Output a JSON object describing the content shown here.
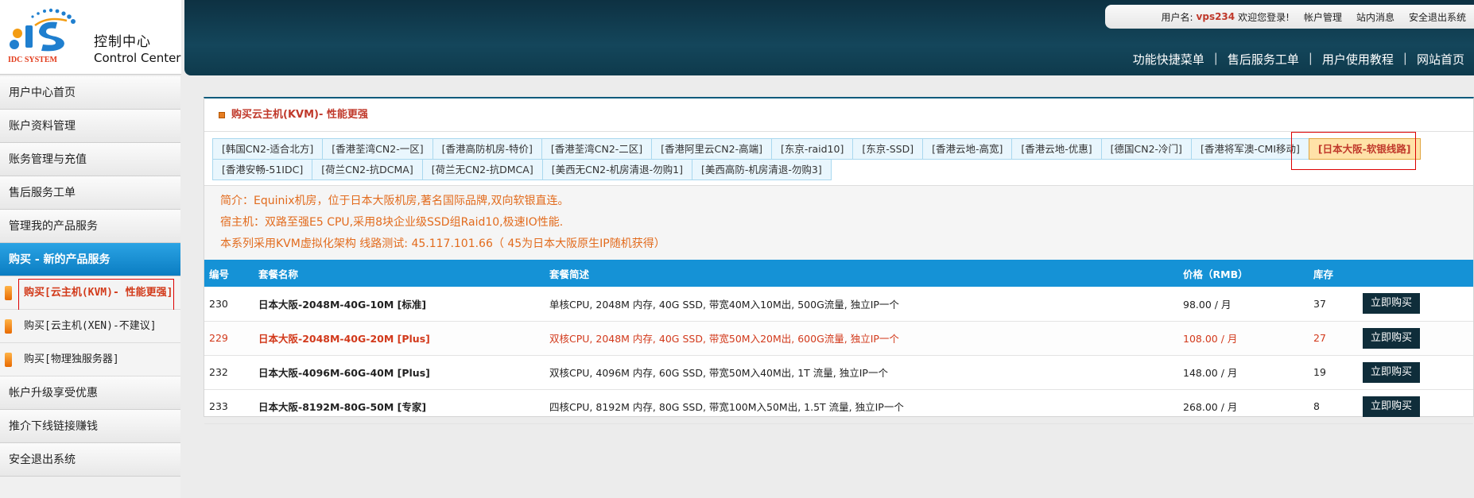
{
  "logo": {
    "brand": "IDC SYSTEM",
    "title_cn": "控制中心",
    "title_en": "Control Center"
  },
  "userbar": {
    "label": "用户名:",
    "username": "vps234",
    "welcome": "欢迎您登录!",
    "links": [
      "帐户管理",
      "站内消息",
      "安全退出系统"
    ]
  },
  "quicknav": [
    "功能快捷菜单",
    "售后服务工单",
    "用户使用教程",
    "网站首页"
  ],
  "sidebar": {
    "items": [
      "用户中心首页",
      "账户资料管理",
      "账务管理与充值",
      "售后服务工单",
      "管理我的产品服务"
    ],
    "active": "购买 - 新的产品服务",
    "sub": [
      "购买[云主机(KVM)- 性能更强]",
      "购买[云主机(XEN)-不建议]",
      "购买[物理独服务器]"
    ],
    "bottom": [
      "帐户升级享受优惠",
      "推介下线链接赚钱",
      "安全退出系统"
    ]
  },
  "panel": {
    "title": "购买云主机(KVM)- 性能更强",
    "tabs": [
      "[韩国CN2-适合北方]",
      "[香港荃湾CN2-一区]",
      "[香港高防机房-特价]",
      "[香港荃湾CN2-二区]",
      "[香港阿里云CN2-高端]",
      "[东京-raid10]",
      "[东京-SSD]",
      "[香港云地-高宽]",
      "[香港云地-优惠]",
      "[德国CN2-冷门]",
      "[香港将军澳-CMI移动]",
      "[日本大阪-软银线路]",
      "[香港安畅-51IDC]",
      "[荷兰CN2-抗DCMA]",
      "[荷兰无CN2-抗DMCA]",
      "[美西无CN2-机房清退-勿购1]",
      "[美西高防-机房清退-勿购3]"
    ],
    "active_tab_index": 11,
    "intro": [
      "简介：Equinix机房，位于日本大阪机房,著名国际品牌,双向软银直连。",
      "宿主机：双路至强E5 CPU,采用8块企业级SSD组Raid10,极速IO性能.",
      "本系列采用KVM虚拟化架构 线路测试: 45.117.101.66（ 45为日本大阪原生IP随机获得）"
    ]
  },
  "table": {
    "headers": [
      "编号",
      "套餐名称",
      "套餐简述",
      "价格（RMB）",
      "库存",
      ""
    ],
    "buy_label": "立即购买",
    "rows": [
      {
        "id": "230",
        "name": "日本大阪-2048M-40G-10M [标准]",
        "desc": "单核CPU, 2048M 内存, 40G SSD, 带宽40M入10M出, 500G流量, 独立IP一个",
        "price": "98.00 / 月",
        "stock": "37"
      },
      {
        "id": "229",
        "name": "日本大阪-2048M-40G-20M [Plus]",
        "desc": "双核CPU, 2048M 内存, 40G SSD, 带宽50M入20M出, 600G流量, 独立IP一个",
        "price": "108.00 / 月",
        "stock": "27"
      },
      {
        "id": "232",
        "name": "日本大阪-4096M-60G-40M [Plus]",
        "desc": "双核CPU, 4096M 内存, 60G SSD, 带宽50M入40M出, 1T 流量, 独立IP一个",
        "price": "148.00 / 月",
        "stock": "19"
      },
      {
        "id": "233",
        "name": "日本大阪-8192M-80G-50M [专家]",
        "desc": "四核CPU, 8192M 内存, 80G SSD, 带宽100M入50M出, 1.5T 流量, 独立IP一个",
        "price": "268.00 / 月",
        "stock": "8"
      }
    ]
  }
}
